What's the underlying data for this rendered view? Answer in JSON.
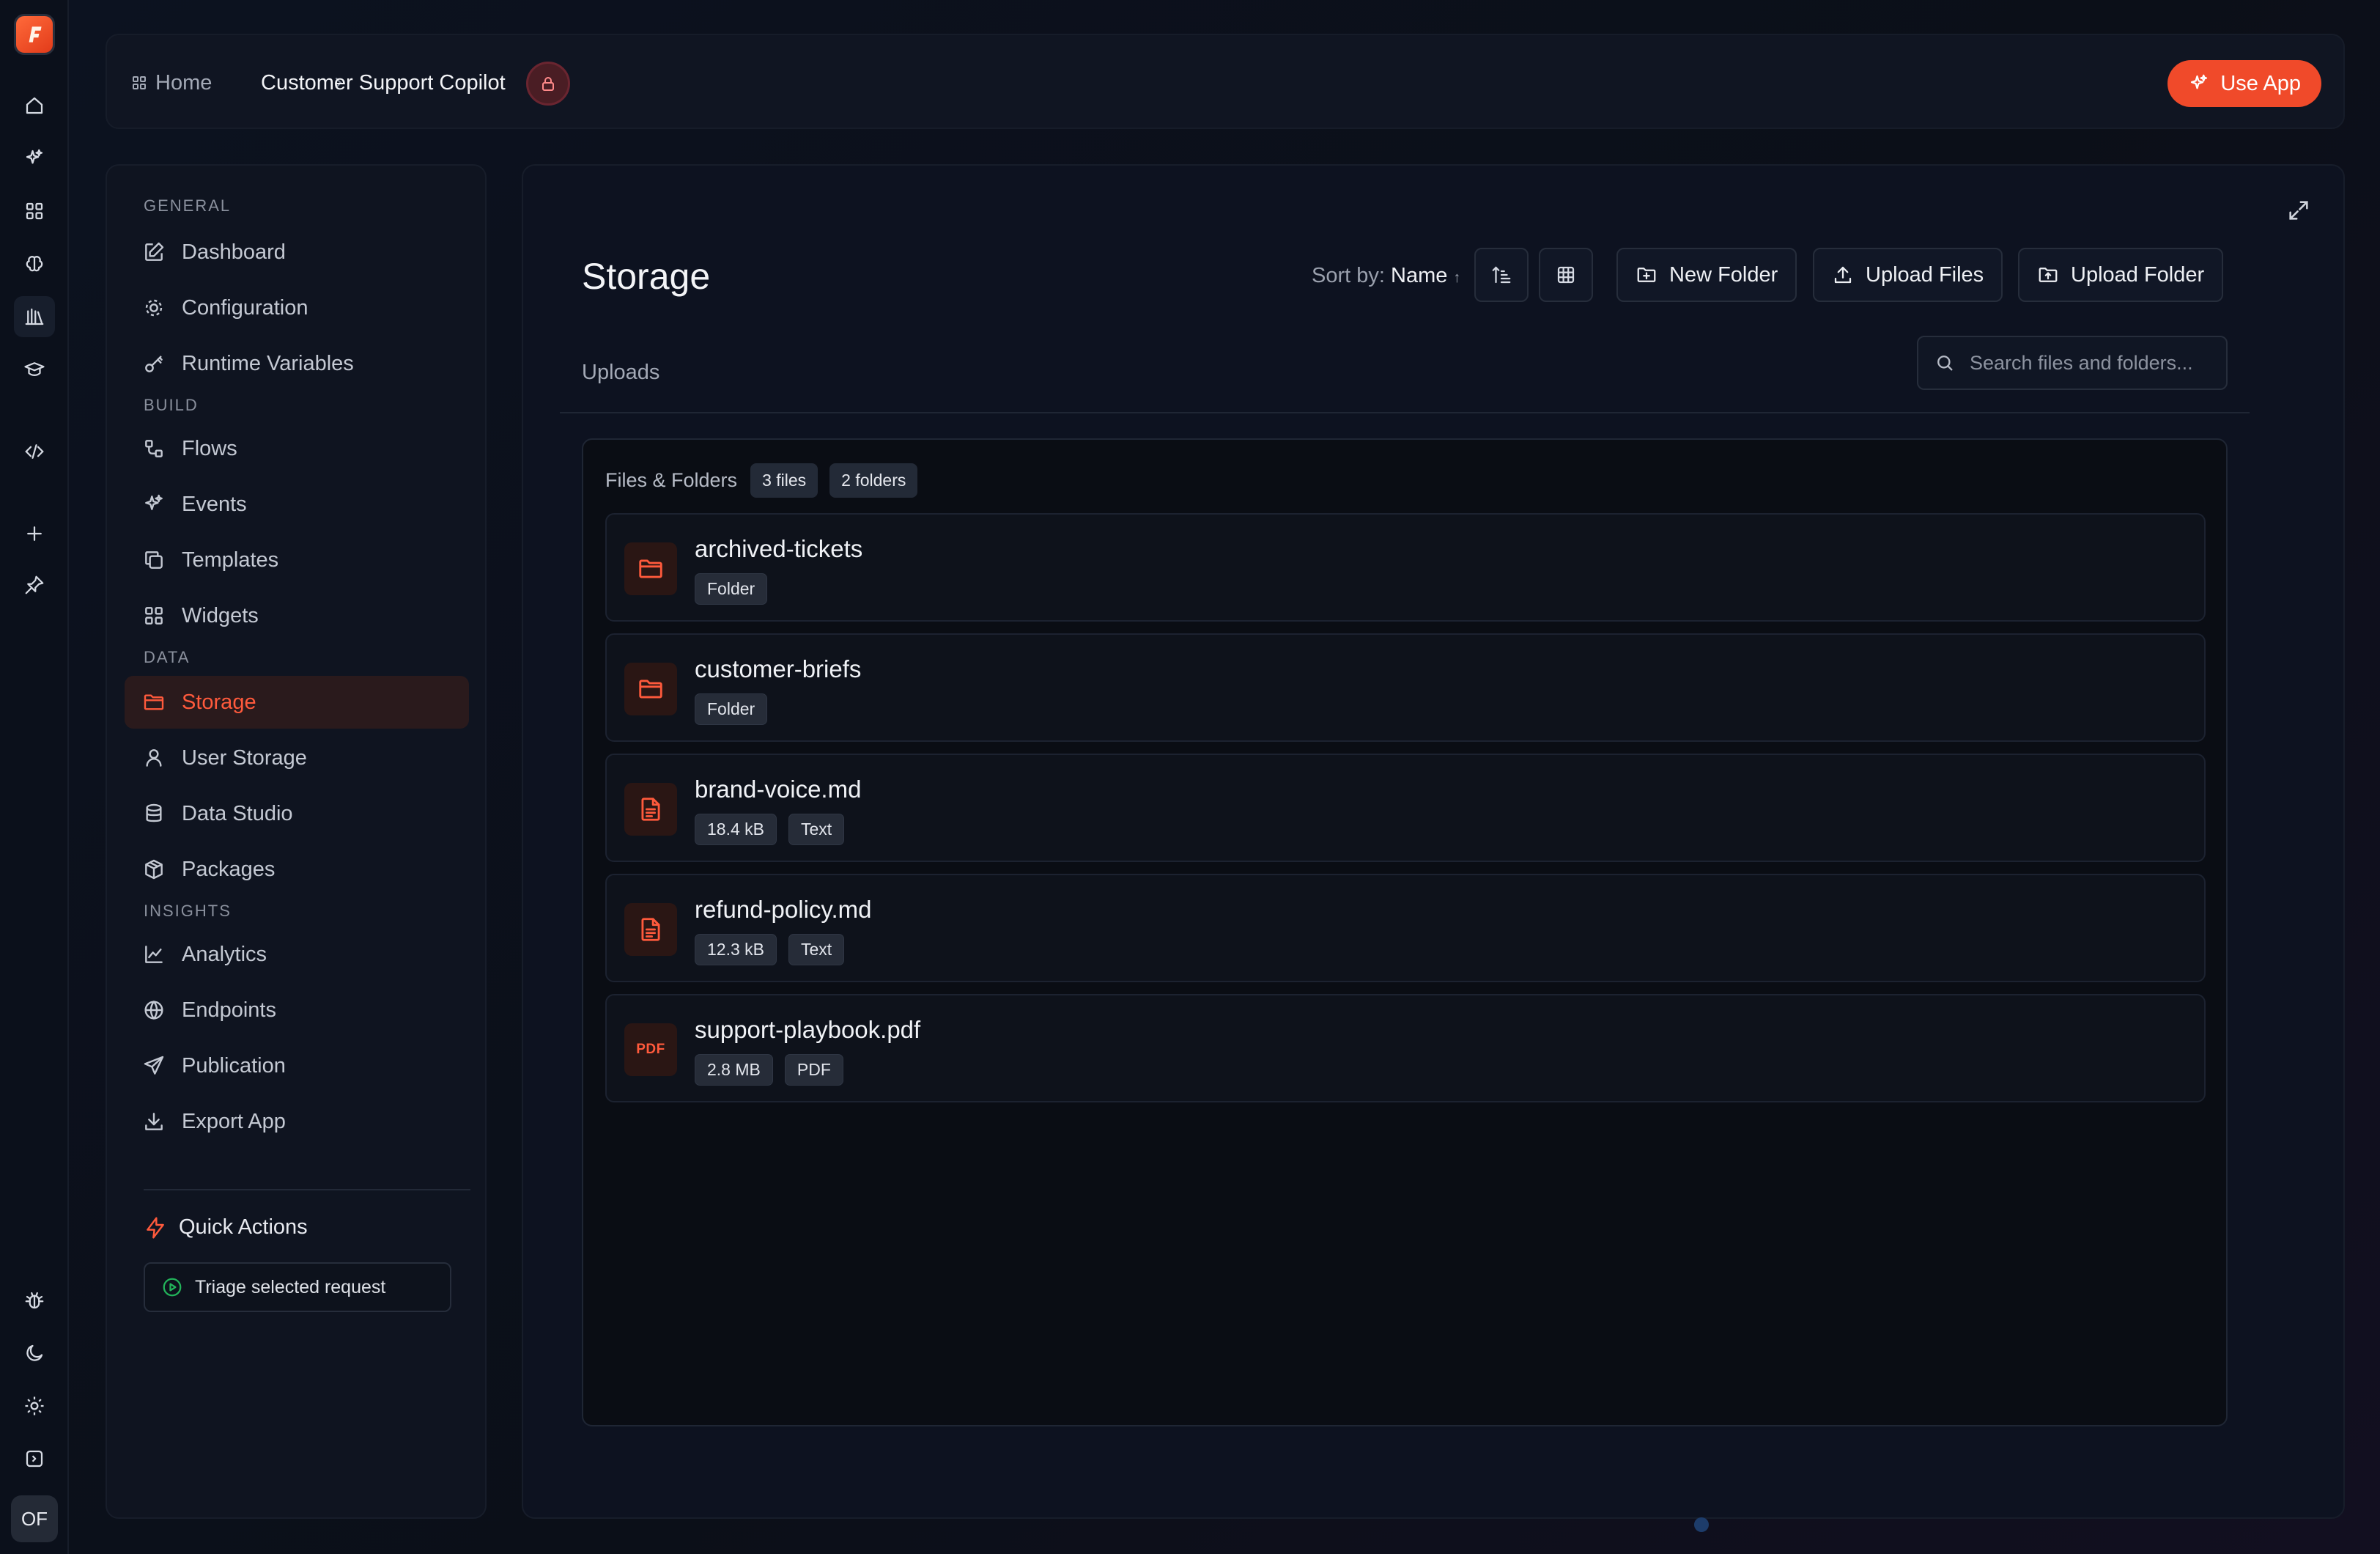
{
  "breadcrumb": {
    "home": "Home",
    "current": "Customer Support Copilot"
  },
  "header": {
    "use_app_label": "Use App"
  },
  "sidebar": {
    "sections": {
      "general": "GENERAL",
      "build": "BUILD",
      "data": "DATA",
      "insights": "INSIGHTS"
    },
    "items": {
      "dashboard": "Dashboard",
      "configuration": "Configuration",
      "runtime_variables": "Runtime Variables",
      "flows": "Flows",
      "events": "Events",
      "templates": "Templates",
      "widgets": "Widgets",
      "storage": "Storage",
      "user_storage": "User Storage",
      "data_studio": "Data Studio",
      "packages": "Packages",
      "analytics": "Analytics",
      "endpoints": "Endpoints",
      "publication": "Publication",
      "export_app": "Export App"
    },
    "active_item": "storage",
    "quick_actions": {
      "title": "Quick Actions",
      "triage": "Triage selected request"
    }
  },
  "rail": {
    "avatar": "OF"
  },
  "main": {
    "title": "Storage",
    "sort": {
      "label": "Sort by:",
      "value": "Name",
      "direction": "↑"
    },
    "actions": {
      "new_folder": "New Folder",
      "upload_files": "Upload Files",
      "upload_folder": "Upload Folder"
    },
    "tab": "Uploads",
    "search": {
      "placeholder": "Search files and folders...",
      "value": ""
    },
    "files_header": {
      "label": "Files & Folders",
      "files_count": "3 files",
      "folders_count": "2 folders"
    },
    "entries": [
      {
        "name": "archived-tickets",
        "kind": "folder",
        "tags": [
          "Folder"
        ]
      },
      {
        "name": "customer-briefs",
        "kind": "folder",
        "tags": [
          "Folder"
        ]
      },
      {
        "name": "brand-voice.md",
        "kind": "text",
        "tags": [
          "18.4 kB",
          "Text"
        ]
      },
      {
        "name": "refund-policy.md",
        "kind": "text",
        "tags": [
          "12.3 kB",
          "Text"
        ]
      },
      {
        "name": "support-playbook.pdf",
        "kind": "pdf",
        "icon_text": "PDF",
        "tags": [
          "2.8 MB",
          "PDF"
        ]
      }
    ]
  },
  "colors": {
    "accent": "#f04a2a",
    "accent_text": "#ff5a3c",
    "background": "#0b0f18",
    "panel": "#0d1220"
  }
}
